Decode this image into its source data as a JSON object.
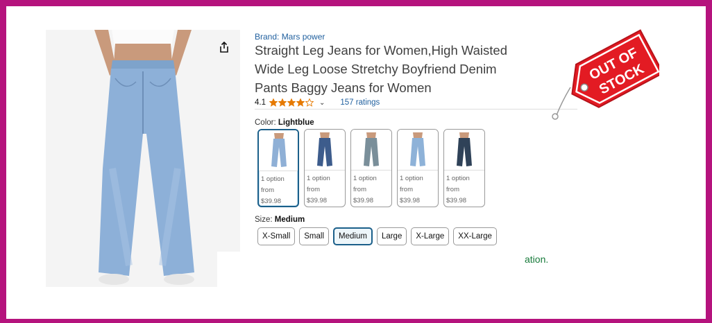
{
  "brand": {
    "label": "Brand: Mars power"
  },
  "product": {
    "title_lines": [
      "Straight Leg Jeans for Women,High Waisted",
      "Wide Leg Loose Stretchy Boyfriend Denim",
      "Pants Baggy Jeans for Women"
    ]
  },
  "rating": {
    "value": "4.1",
    "stars": 4.1,
    "count_text": "157 ratings",
    "chevron": "⌄"
  },
  "color": {
    "label": "Color: ",
    "selected": "Lightblue",
    "options": [
      {
        "line1": "1 option",
        "line2": "from",
        "price": "$39.98",
        "denim": "#8fb0d6",
        "selected": true
      },
      {
        "line1": "1 option",
        "line2": "from",
        "price": "$39.98",
        "denim": "#3d5c8c",
        "selected": false
      },
      {
        "line1": "1 option",
        "line2": "from",
        "price": "$39.98",
        "denim": "#7a8f9a",
        "selected": false
      },
      {
        "line1": "1 option",
        "line2": "from",
        "price": "$39.98",
        "denim": "#8eb2d8",
        "selected": false
      },
      {
        "line1": "1 option",
        "line2": "from",
        "price": "$39.98",
        "denim": "#2f4258",
        "selected": false
      }
    ]
  },
  "size": {
    "label": "Size: ",
    "selected": "Medium",
    "options": [
      "X-Small",
      "Small",
      "Medium",
      "Large",
      "X-Large",
      "XX-Large"
    ]
  },
  "availability": {
    "text": "ation."
  },
  "out_of_stock": {
    "line1": "OUT OF",
    "line2": "STOCK"
  },
  "colors": {
    "frame": "#b5137d",
    "link": "#1f5f9e",
    "star": "#e67a00",
    "tag": "#e31b23",
    "selected_border": "#1b5f8a"
  }
}
